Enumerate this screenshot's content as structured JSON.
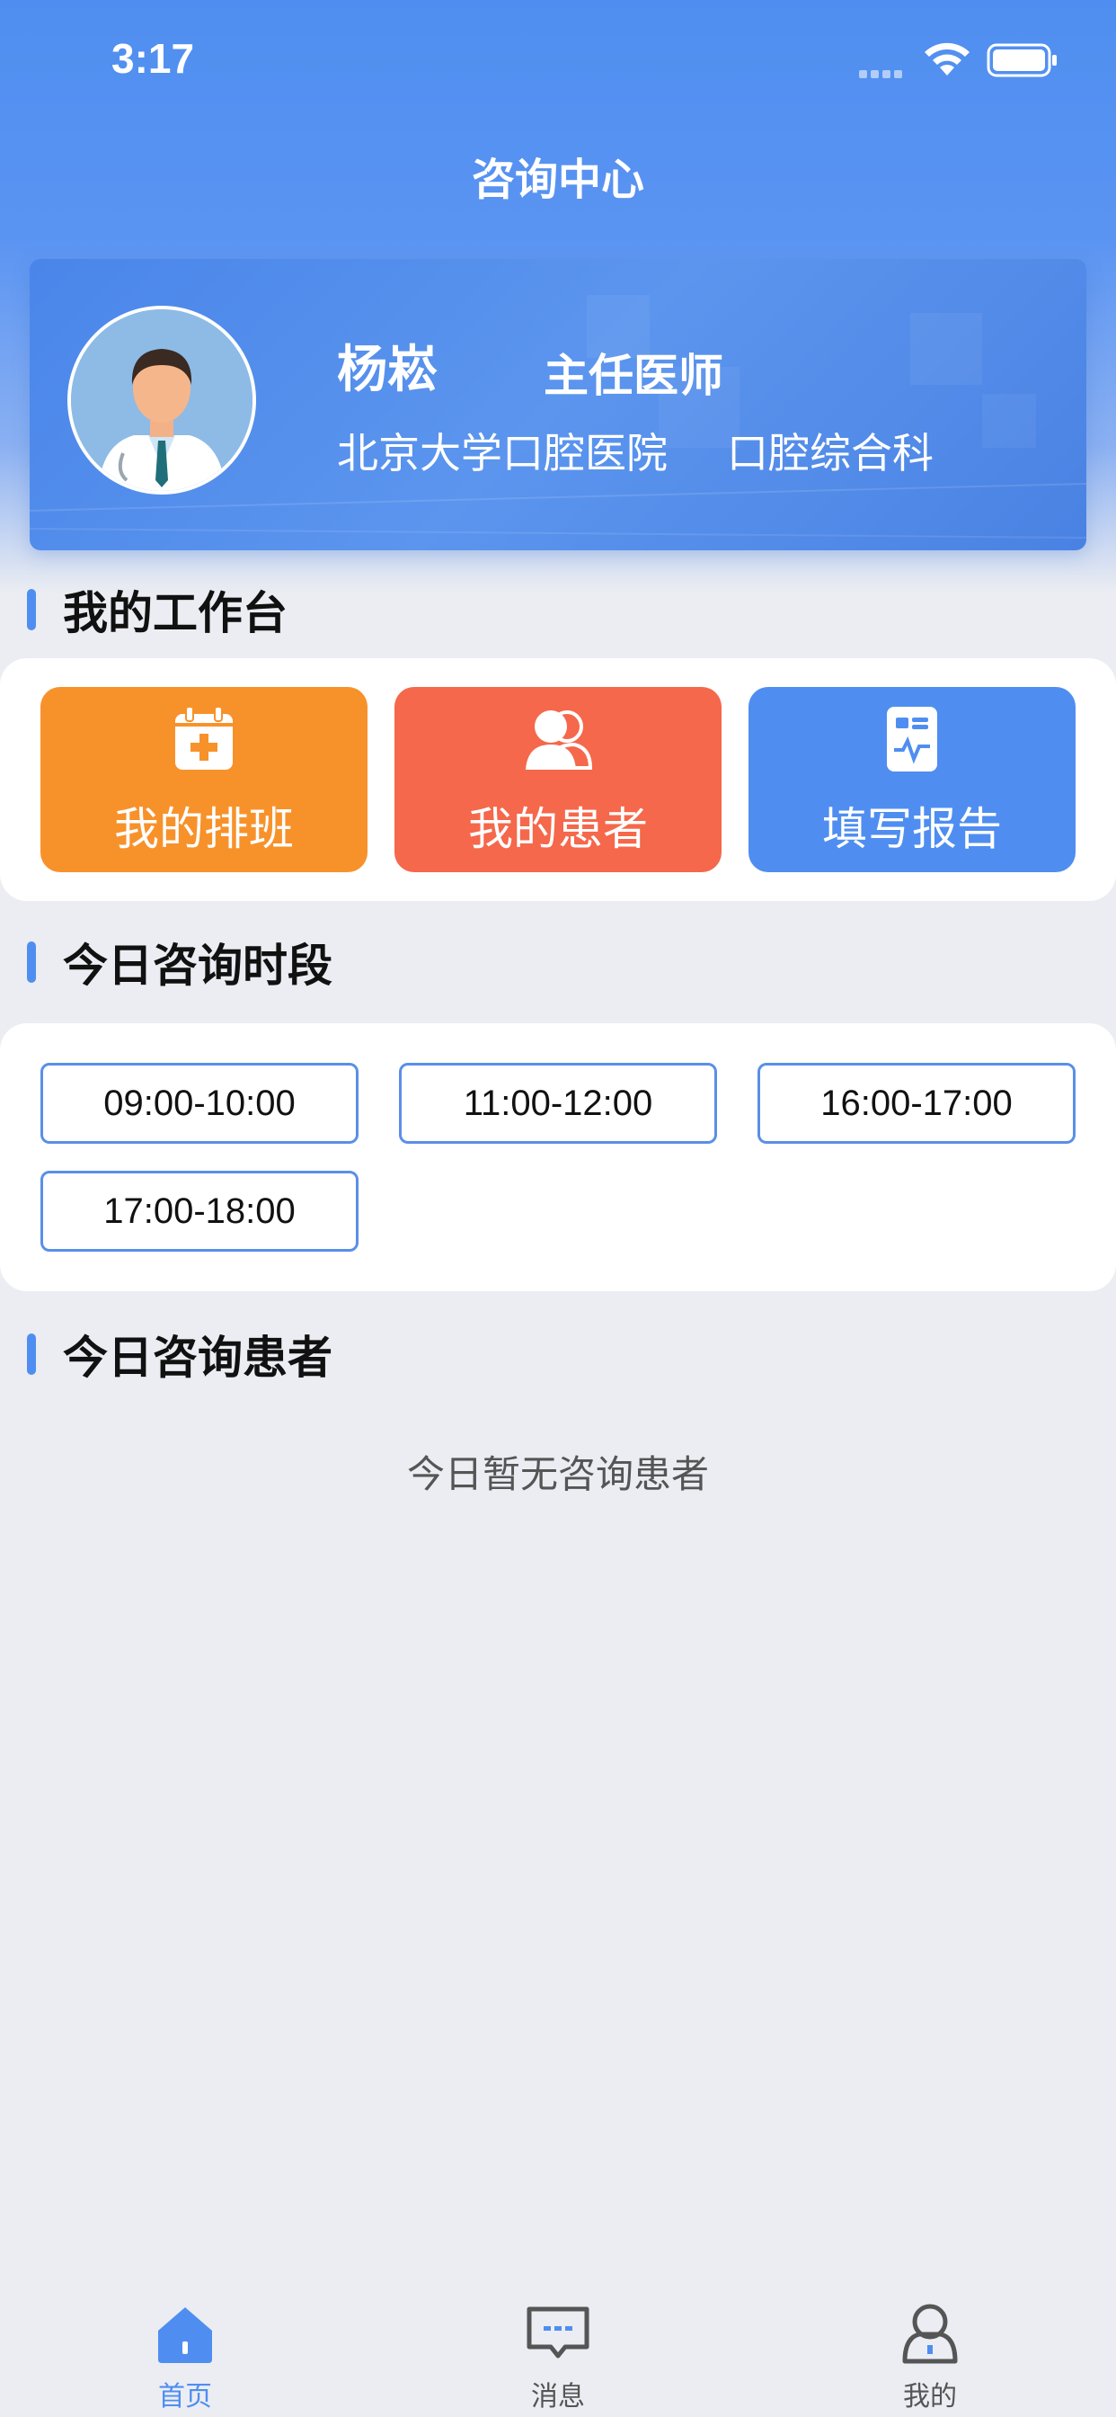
{
  "status_bar": {
    "time": "3:17"
  },
  "page": {
    "title": "咨询中心"
  },
  "doctor": {
    "name": "杨崧",
    "title": "主任医师",
    "hospital": "北京大学口腔医院",
    "department": "口腔综合科"
  },
  "workbench": {
    "section_title": "我的工作台",
    "buttons": [
      {
        "label": "我的排班",
        "icon": "calendar-plus-icon",
        "color": "#f7922b"
      },
      {
        "label": "我的患者",
        "icon": "patients-icon",
        "color": "#f5684b"
      },
      {
        "label": "填写报告",
        "icon": "report-icon",
        "color": "#4f8ef0"
      }
    ]
  },
  "timeslots": {
    "section_title": "今日咨询时段",
    "items": [
      "09:00-10:00",
      "11:00-12:00",
      "16:00-17:00",
      "17:00-18:00"
    ]
  },
  "patients": {
    "section_title": "今日咨询患者",
    "empty_text": "今日暂无咨询患者"
  },
  "tabbar": {
    "items": [
      {
        "label": "首页",
        "icon": "home-icon",
        "active": true
      },
      {
        "label": "消息",
        "icon": "message-icon",
        "active": false
      },
      {
        "label": "我的",
        "icon": "profile-icon",
        "active": false
      }
    ]
  },
  "colors": {
    "primary": "#4f8ef0",
    "orange": "#f7922b",
    "coral": "#f5684b",
    "background": "#ebedf2"
  }
}
